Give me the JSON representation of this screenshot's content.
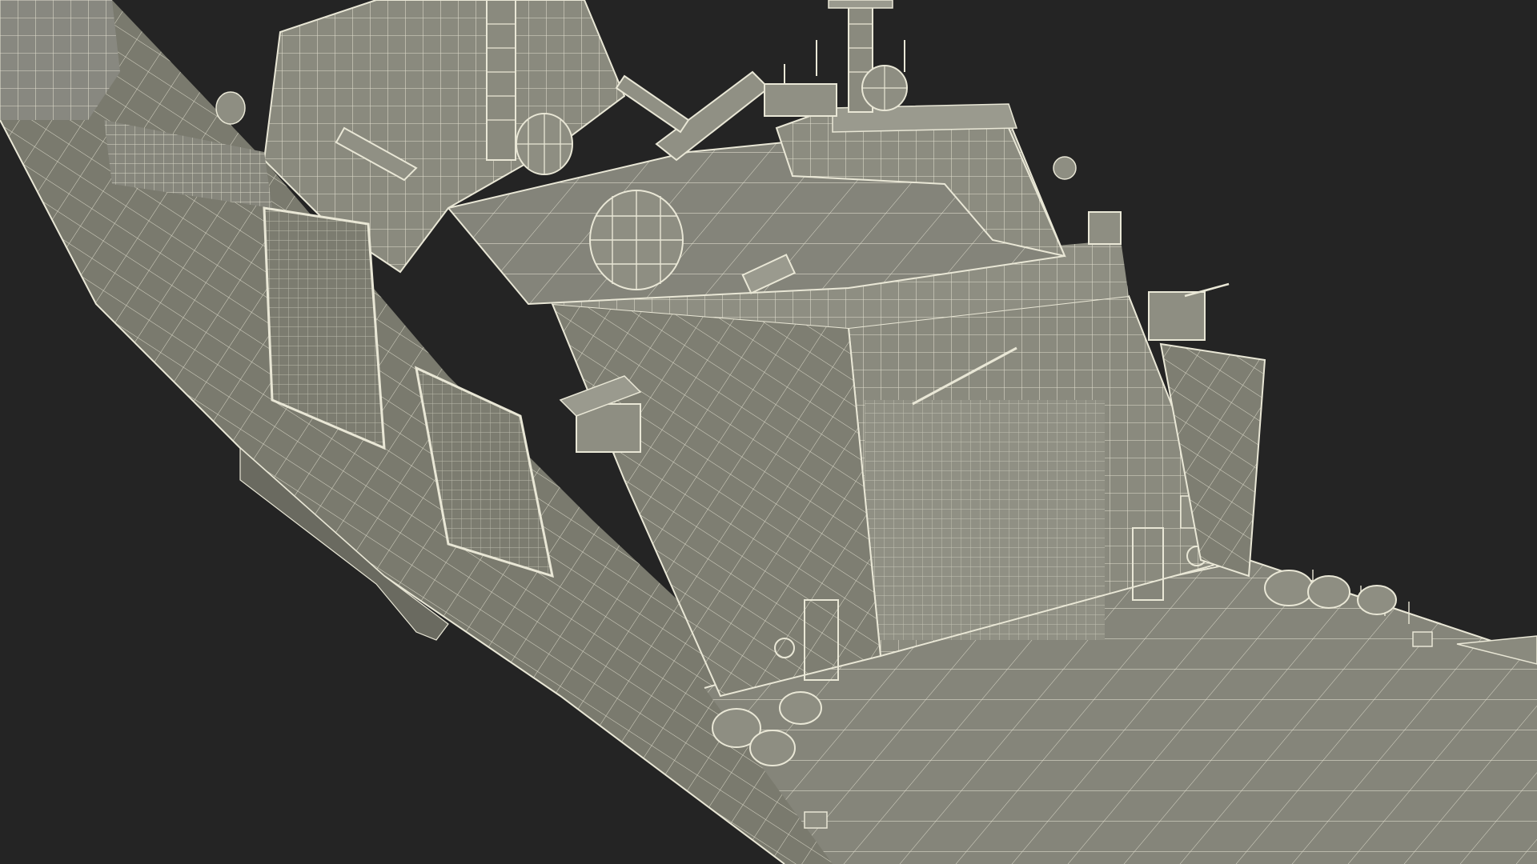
{
  "scene": {
    "subject": "warship-wireframe-render",
    "colors": {
      "background": "#242424",
      "hull_fill": "#7c7c70",
      "deck_fill": "#85857a",
      "superstructure_fill": "#8a8a7e",
      "shadow_fill": "#6a6a60",
      "wire": "#e9e7d6",
      "wire_soft": "#cfcdbc"
    },
    "icons": {
      "radome": "radome-icon",
      "gun_turret": "gun-turret-icon",
      "mast": "mast-icon",
      "missile_launcher": "missile-launcher-icon",
      "hangar_door": "hangar-door-icon",
      "railing": "railing-icon"
    }
  }
}
